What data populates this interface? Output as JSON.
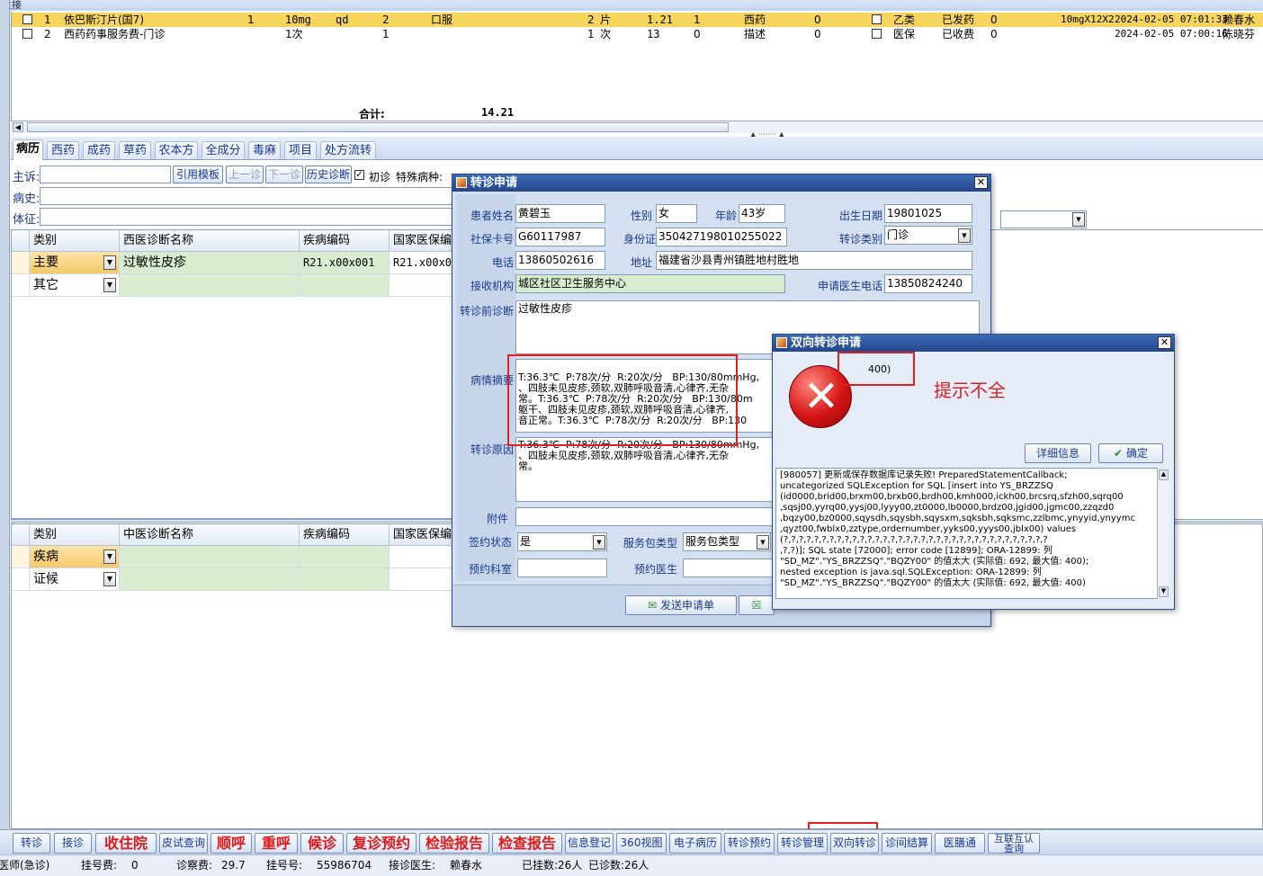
{
  "topbar": {
    "title": "主接"
  },
  "orders": {
    "rows": [
      {
        "no": "1",
        "name": "依巴斯汀片(国7)",
        "qty": "1",
        "dose": "10mg",
        "freq": "qd",
        "days": "2",
        "route": "口服",
        "total": "2",
        "unit": "片",
        "price": "1.21",
        "amount": "1",
        "type": "西药",
        "zero": "0",
        "ins": "乙类",
        "status": "已发药",
        "flag": "0",
        "spec": "10mgX12X2",
        "time": "2024-02-05 07:01:33",
        "doctor": "赖春水"
      },
      {
        "no": "2",
        "name": "西药药事服务费-门诊",
        "qty": "",
        "dose": "1次",
        "freq": "",
        "days": "1",
        "route": "",
        "total": "1",
        "unit": "次",
        "price": "13",
        "amount": "0",
        "type": "描述",
        "zero": "0",
        "ins": "医保",
        "status": "已收费",
        "flag": "0",
        "spec": "",
        "time": "2024-02-05 07:00:16",
        "doctor": "陈晓芬"
      }
    ],
    "total_label": "合计:",
    "total_value": "14.21"
  },
  "tabs": [
    "病历",
    "西药",
    "成药",
    "草药",
    "农本方",
    "全成分",
    "毒麻",
    "项目",
    "处方流转"
  ],
  "record": {
    "chief_label": "主诉:",
    "history_label": "病史:",
    "exam_label": "体征:",
    "btn_template": "引用模板",
    "btn_prev": "上一诊",
    "btn_next": "下一诊",
    "btn_history": "历史诊断",
    "first_visit": "初诊",
    "special_label": "特殊病种:"
  },
  "west_table": {
    "headers": [
      "类别",
      "西医诊断名称",
      "疾病编码",
      "国家医保编码"
    ],
    "rows": [
      {
        "category": "主要",
        "name": "过敏性皮疹",
        "code": "R21.x00x001",
        "nat": "R21.x00x0"
      },
      {
        "category": "其它",
        "name": "",
        "code": "",
        "nat": ""
      }
    ]
  },
  "tcm_table": {
    "headers": [
      "类别",
      "中医诊断名称",
      "疾病编码",
      "国家医保编码"
    ],
    "rows": [
      {
        "category": "疾病"
      },
      {
        "category": "证候"
      }
    ]
  },
  "referral": {
    "title": "转诊申请",
    "name_label": "患者姓名",
    "name": "黄碧玉",
    "sex_label": "性别",
    "sex": "女",
    "age_label": "年龄",
    "age": "43岁",
    "birth_label": "出生日期",
    "birth": "19801025",
    "card_label": "社保卡号",
    "card": "G60117987",
    "id_label": "身份证",
    "id": "350427198010255022",
    "rtype_label": "转诊类别",
    "rtype": "门诊",
    "phone_label": "电话",
    "phone": "13860502616",
    "addr_label": "地址",
    "addr": "福建省沙县青州镇胜地村胜地",
    "org_label": "接收机构",
    "org": "城区社区卫生服务中心",
    "docphone_label": "申请医生电话",
    "docphone": "13850824240",
    "prediag_label": "转诊前诊断",
    "prediag": "过敏性皮疹",
    "summary_label": "病情摘要",
    "summary": "T:36.3℃  P:78次/分  R:20次/分   BP:130/80mmHg,\n、四肢未见皮疹,颈软,双肺呼吸音清,心律齐,无杂\n常。T:36.3℃  P:78次/分  R:20次/分   BP:130/80m\n躯干、四肢未见皮疹,颈软,双肺呼吸音清,心律齐,\n音正常。T:36.3℃  P:78次/分  R:20次/分   BP:130",
    "reason_label": "转诊原因",
    "reason": "T:36.3℃  P:78次/分  R:20次/分   BP:130/80mmHg,\n、四肢未见皮疹,颈软,双肺呼吸音清,心律齐,无杂\n常。",
    "attach_label": "附件",
    "sign_label": "签约状态",
    "sign": "是",
    "pkg_label": "服务包类型",
    "pkg": "服务包类型",
    "dept_label": "预约科室",
    "doc_label": "预约医生",
    "send_btn": "发送申请单"
  },
  "error_dialog": {
    "title": "双向转诊申请",
    "short_msg": "400)",
    "detail_btn": "详细信息",
    "ok_btn": "确定",
    "detail": "[980057] 更新或保存数据库记录失败! PreparedStatementCallback;\nuncategorized SQLException for SQL [insert into YS_BRZZSQ\n(id0000,brid00,brxm00,brxb00,brdh00,kmh000,ickh00,brcsrq,sfzh00,sqrq00\n,sqsj00,yyrq00,yysj00,lyyy00,zt0000,lb0000,brdz00,jgid00,jgmc00,zzqzd0\n,bqzy00,bz0000,sqysdh,sqysbh,sqysxm,sqksbh,sqksmc,zzlbmc,ynyyid,ynyymc\n,qyzt00,fwblx0,zztype,ordernumber,yyks00,yyys00,jblx00) values\n(?,?,?,?,?,?,?,?,?,?,?,?,?,?,?,?,?,?,?,?,?,?,?,?,?,?,?,?,?,?,?,?,?,?,?\n,?,?)]; SQL state [72000]; error code [12899]; ORA-12899: 列\n\"SD_MZ\".\"YS_BRZZSQ\".\"BQZY00\" 的值太大 (实际值: 692, 最大值: 400);\nnested exception is java.sql.SQLException: ORA-12899: 列\n\"SD_MZ\".\"YS_BRZZSQ\".\"BQZY00\" 的值太大 (实际值: 692, 最大值: 400)"
  },
  "annotation": {
    "text": "提示不全",
    "color": "#e02020"
  },
  "bottom_buttons": [
    {
      "label": "转诊",
      "red": false
    },
    {
      "label": "接诊",
      "red": false
    },
    {
      "label": "收住院",
      "red": true
    },
    {
      "label": "皮试查询",
      "red": false
    },
    {
      "label": "顺呼",
      "red": true
    },
    {
      "label": "重呼",
      "red": true
    },
    {
      "label": "候诊",
      "red": true
    },
    {
      "label": "复诊预约",
      "red": true
    },
    {
      "label": "检验报告",
      "red": true
    },
    {
      "label": "检查报告",
      "red": true
    },
    {
      "label": "信息登记",
      "red": false
    },
    {
      "label": "360视图",
      "red": false
    },
    {
      "label": "电子病历",
      "red": false
    },
    {
      "label": "转诊预约",
      "red": false
    },
    {
      "label": "转诊管理",
      "red": false
    },
    {
      "label": "双向转诊",
      "red": false
    },
    {
      "label": "诊间结算",
      "red": false
    },
    {
      "label": "医膳通",
      "red": false
    },
    {
      "label": "互联互认\n查询",
      "red": false
    }
  ],
  "status": {
    "role": "医师(急诊)",
    "reg_fee_label": "挂号费:",
    "reg_fee": "0",
    "exam_fee_label": "诊察费:",
    "exam_fee": "29.7",
    "reg_no_label": "挂号号:",
    "reg_no": "55986704",
    "doctor_label": "接诊医生:",
    "doctor": "赖春水",
    "registered": "已挂数:26人",
    "seen": "已诊数:26人"
  }
}
